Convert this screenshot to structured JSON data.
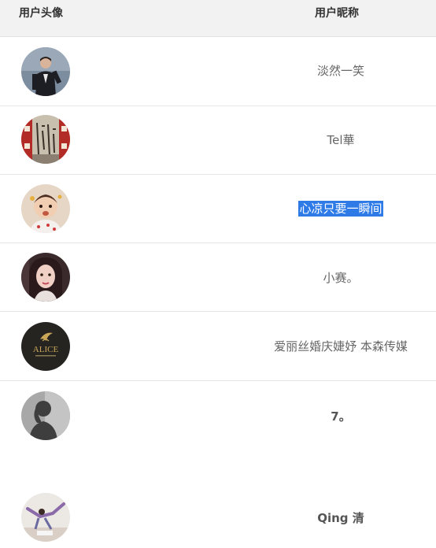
{
  "header": {
    "avatar_col": "用户头像",
    "nickname_col": "用户昵称"
  },
  "rows": [
    {
      "avatar": "avatar-man-in-suit",
      "nickname": "淡然一笑"
    },
    {
      "avatar": "avatar-calligraphy",
      "nickname": "Tel華"
    },
    {
      "avatar": "avatar-baby",
      "nickname": "心凉只要一瞬间"
    },
    {
      "avatar": "avatar-woman-selfie",
      "nickname": "小赛。"
    },
    {
      "avatar": "avatar-alice-logo",
      "nickname": "爱丽丝婚庆婕妤 本森传媒",
      "logo_text": "ALICE"
    },
    {
      "avatar": "avatar-silhouette",
      "nickname": "7。"
    },
    {
      "avatar": "avatar-dancer",
      "nickname": "Qing 清"
    }
  ],
  "colors": {
    "header_bg": "#f2f2f2",
    "selection": "#2e7be8",
    "divider": "#e6e6e6"
  }
}
